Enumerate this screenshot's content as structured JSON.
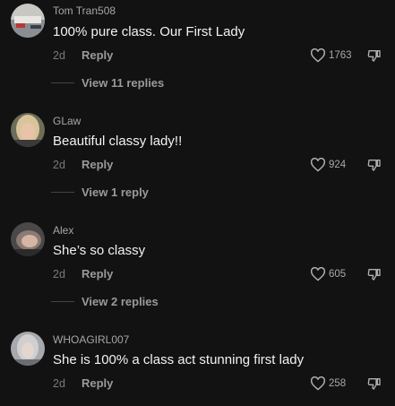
{
  "comments": [
    {
      "username": "Tom Tran508",
      "text": "100% pure class. Our First Lady",
      "time": "2d",
      "reply_label": "Reply",
      "likes": "1763",
      "view_replies": "View 11 replies"
    },
    {
      "username": "GLaw",
      "text": "Beautiful classy lady!!",
      "time": "2d",
      "reply_label": "Reply",
      "likes": "924",
      "view_replies": "View 1 reply"
    },
    {
      "username": "Alex",
      "text": "She’s so classy",
      "time": "2d",
      "reply_label": "Reply",
      "likes": "605",
      "view_replies": "View 2 replies"
    },
    {
      "username": "WHOAGIRL007",
      "text": "She is 100% a class act stunning first lady",
      "time": "2d",
      "reply_label": "Reply",
      "likes": "258"
    }
  ],
  "icons": {
    "like": "heart-outline-icon",
    "dislike": "thumbs-down-icon"
  },
  "colors": {
    "background": "#121212",
    "text_primary": "#f2f2f2",
    "text_secondary": "#9a9a9a"
  }
}
